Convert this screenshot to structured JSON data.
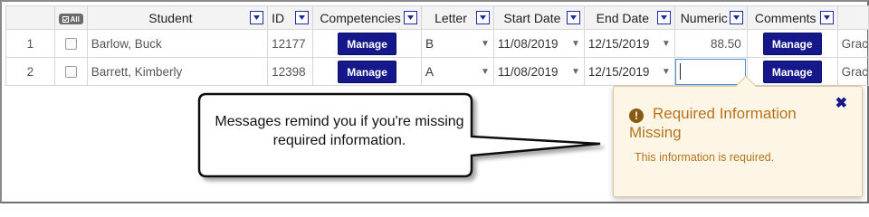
{
  "grid": {
    "all_label": "All",
    "columns": [
      "Student",
      "ID",
      "Competencies",
      "Letter",
      "Start Date",
      "End Date",
      "Numeric",
      "Comments"
    ],
    "rows": [
      {
        "num": "1",
        "student": "Barlow, Buck",
        "id": "12177",
        "competencies": "Manage",
        "letter": "B",
        "start_date": "11/08/2019",
        "end_date": "12/15/2019",
        "numeric": "88.50",
        "comments": "Manage",
        "next_col": "Grac"
      },
      {
        "num": "2",
        "student": "Barrett, Kimberly",
        "id": "12398",
        "competencies": "Manage",
        "letter": "A",
        "start_date": "11/08/2019",
        "end_date": "12/15/2019",
        "numeric": "",
        "comments": "Manage",
        "next_col": "Grac"
      }
    ]
  },
  "callout": {
    "text": "Messages remind you if you're missing required information."
  },
  "popup": {
    "title": "Required Information Missing",
    "message": "This information is required.",
    "close": "✖"
  }
}
